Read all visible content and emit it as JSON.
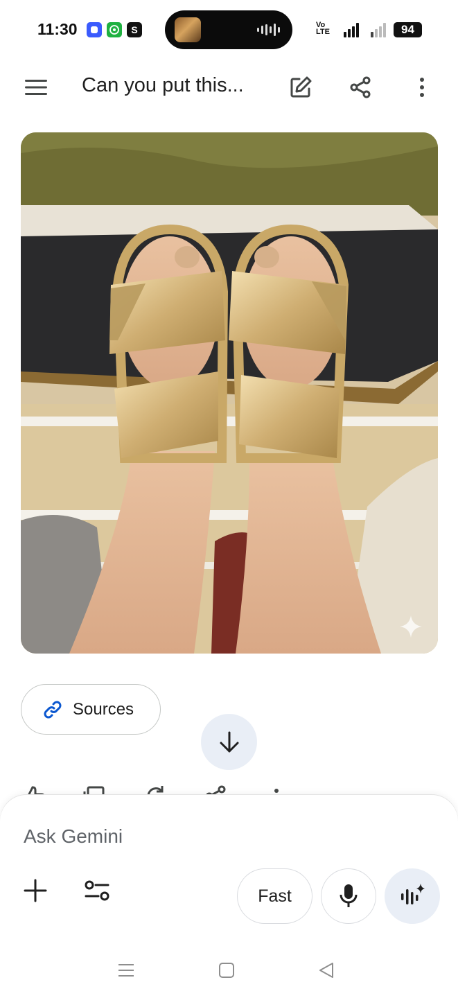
{
  "status_bar": {
    "time": "11:30",
    "app_icons": [
      {
        "name": "messenger-icon",
        "glyph": "●",
        "color": "#3b5bfd"
      },
      {
        "name": "whatsapp-icon",
        "glyph": "✆",
        "color": "#1fb141"
      },
      {
        "name": "s-app-icon",
        "glyph": "S",
        "color": "#111111"
      }
    ],
    "network_label": "Vo LTE",
    "battery": "94"
  },
  "header": {
    "title": "Can you put this..."
  },
  "response": {
    "image_alt": "Feet wearing gold metallic slide sandals with glitter straps"
  },
  "sources": {
    "label": "Sources"
  },
  "input": {
    "placeholder": "Ask Gemini",
    "mode_label": "Fast"
  },
  "colors": {
    "accent_blue": "#0b57d0",
    "chip_bg": "#e9eef6",
    "text": "#1f1f1f"
  }
}
